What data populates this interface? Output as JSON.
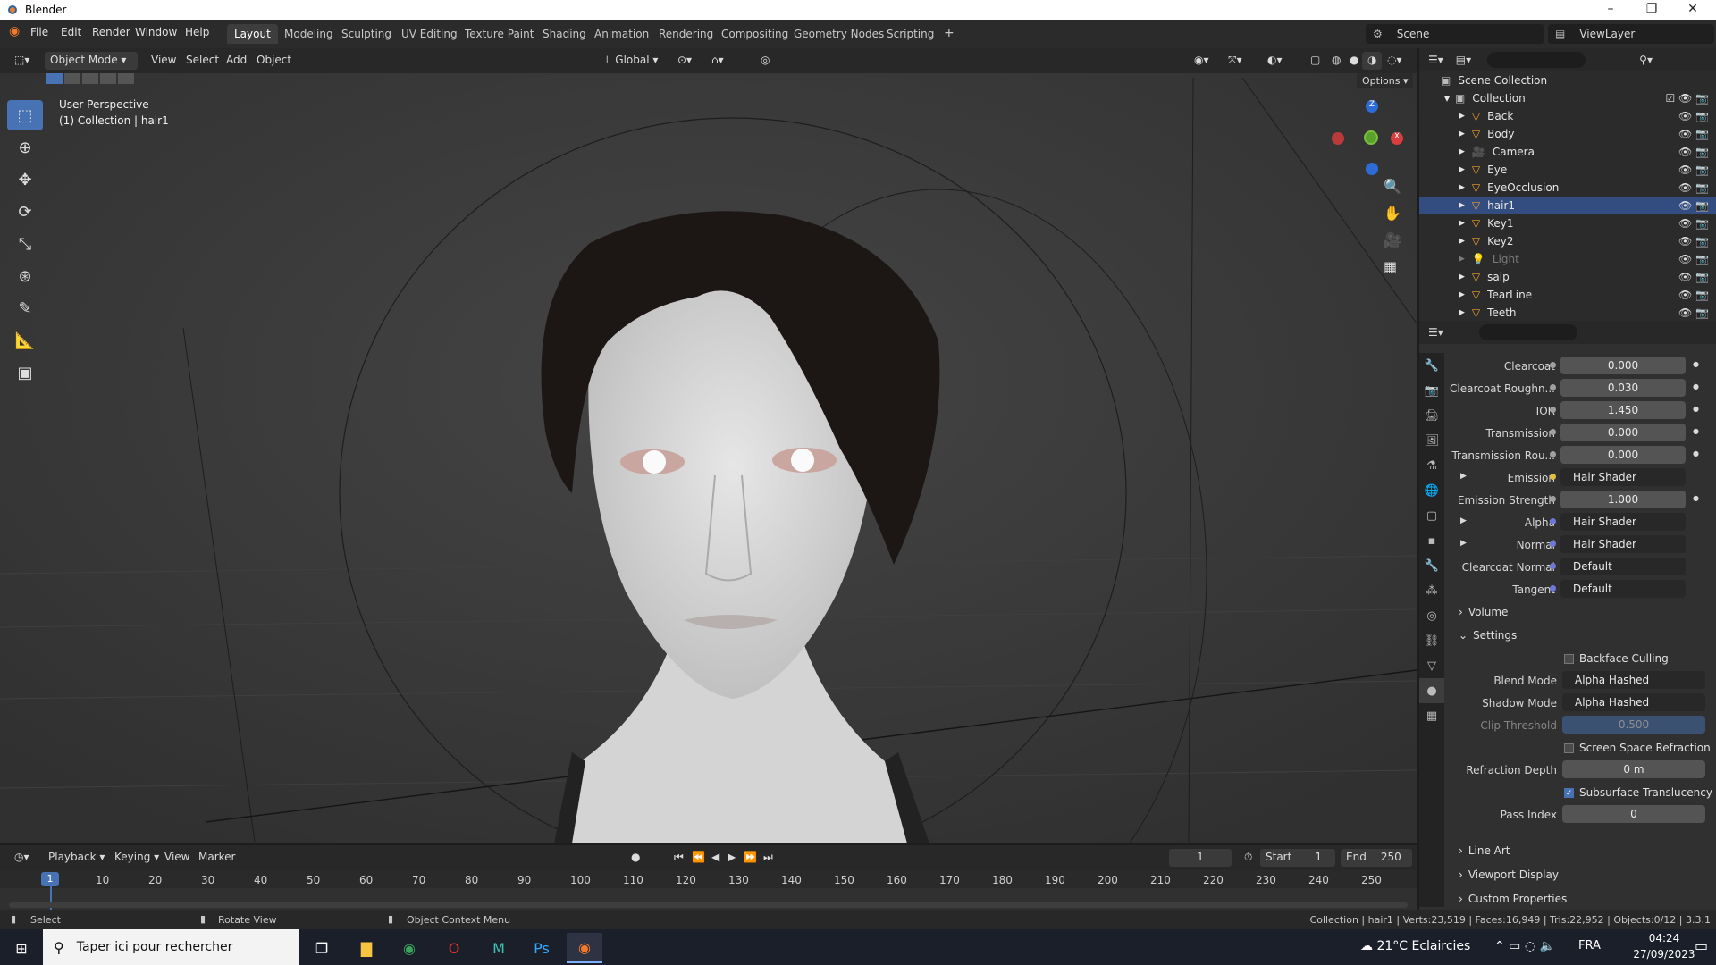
{
  "window": {
    "title": "Blender"
  },
  "menu": {
    "file": "File",
    "edit": "Edit",
    "render": "Render",
    "window": "Window",
    "help": "Help"
  },
  "workspaces": [
    "Layout",
    "Modeling",
    "Sculpting",
    "UV Editing",
    "Texture Paint",
    "Shading",
    "Animation",
    "Rendering",
    "Compositing",
    "Geometry Nodes",
    "Scripting"
  ],
  "scene": {
    "name": "Scene",
    "view_layer": "ViewLayer"
  },
  "viewport": {
    "mode": "Object Mode",
    "view": "View",
    "select": "Select",
    "add": "Add",
    "object": "Object",
    "orientation": "Global",
    "options": "Options",
    "perspective_label": "User Perspective",
    "collection_label": "(1) Collection | hair1"
  },
  "outliner": {
    "root": "Scene Collection",
    "collection": "Collection",
    "items": [
      {
        "name": "Back"
      },
      {
        "name": "Body"
      },
      {
        "name": "Camera"
      },
      {
        "name": "Eye"
      },
      {
        "name": "EyeOcclusion"
      },
      {
        "name": "hair1"
      },
      {
        "name": "Key1"
      },
      {
        "name": "Key2"
      },
      {
        "name": "Light"
      },
      {
        "name": "salp"
      },
      {
        "name": "TearLine"
      },
      {
        "name": "Teeth"
      }
    ]
  },
  "properties": {
    "rows": [
      {
        "label": "Clearcoat",
        "value": "0.000"
      },
      {
        "label": "Clearcoat Roughn...",
        "value": "0.030"
      },
      {
        "label": "IOR",
        "value": "1.450"
      },
      {
        "label": "Transmission",
        "value": "0.000"
      },
      {
        "label": "Transmission Rou...",
        "value": "0.000"
      },
      {
        "label": "Emission",
        "value": "Hair Shader"
      },
      {
        "label": "Emission Strength",
        "value": "1.000"
      },
      {
        "label": "Alpha",
        "value": "Hair Shader"
      },
      {
        "label": "Normal",
        "value": "Hair Shader"
      },
      {
        "label": "Clearcoat Normal",
        "value": "Default"
      },
      {
        "label": "Tangent",
        "value": "Default"
      }
    ],
    "volume": "Volume",
    "settings": "Settings",
    "backface_culling": "Backface Culling",
    "blend_mode_label": "Blend Mode",
    "blend_mode": "Alpha Hashed",
    "shadow_mode_label": "Shadow Mode",
    "shadow_mode": "Alpha Hashed",
    "clip_threshold_label": "Clip Threshold",
    "clip_threshold": "0.500",
    "ssr": "Screen Space Refraction",
    "refraction_depth_label": "Refraction Depth",
    "refraction_depth": "0 m",
    "subsurface": "Subsurface Translucency",
    "pass_index_label": "Pass Index",
    "pass_index": "0",
    "line_art": "Line Art",
    "viewport_display": "Viewport Display",
    "custom_properties": "Custom Properties"
  },
  "timeline": {
    "playback": "Playback",
    "keying": "Keying",
    "view": "View",
    "marker": "Marker",
    "current_frame": "1",
    "start_label": "Start",
    "start": "1",
    "end_label": "End",
    "end": "250",
    "ticks": [
      "10",
      "20",
      "30",
      "40",
      "50",
      "60",
      "70",
      "80",
      "90",
      "100",
      "110",
      "120",
      "130",
      "140",
      "150",
      "160",
      "170",
      "180",
      "190",
      "200",
      "210",
      "220",
      "230",
      "240",
      "250"
    ],
    "playhead": "1"
  },
  "status": {
    "select": "Select",
    "rotate": "Rotate View",
    "context": "Object Context Menu",
    "stats": "Collection | hair1 | Verts:23,519 | Faces:16,949 | Tris:22,952 | Objects:0/12 | 3.3.1"
  },
  "taskbar": {
    "search_placeholder": "Taper ici pour rechercher",
    "weather": "21°C  Eclaircies",
    "lang": "FRA",
    "time": "04:24",
    "date": "27/09/2023"
  }
}
